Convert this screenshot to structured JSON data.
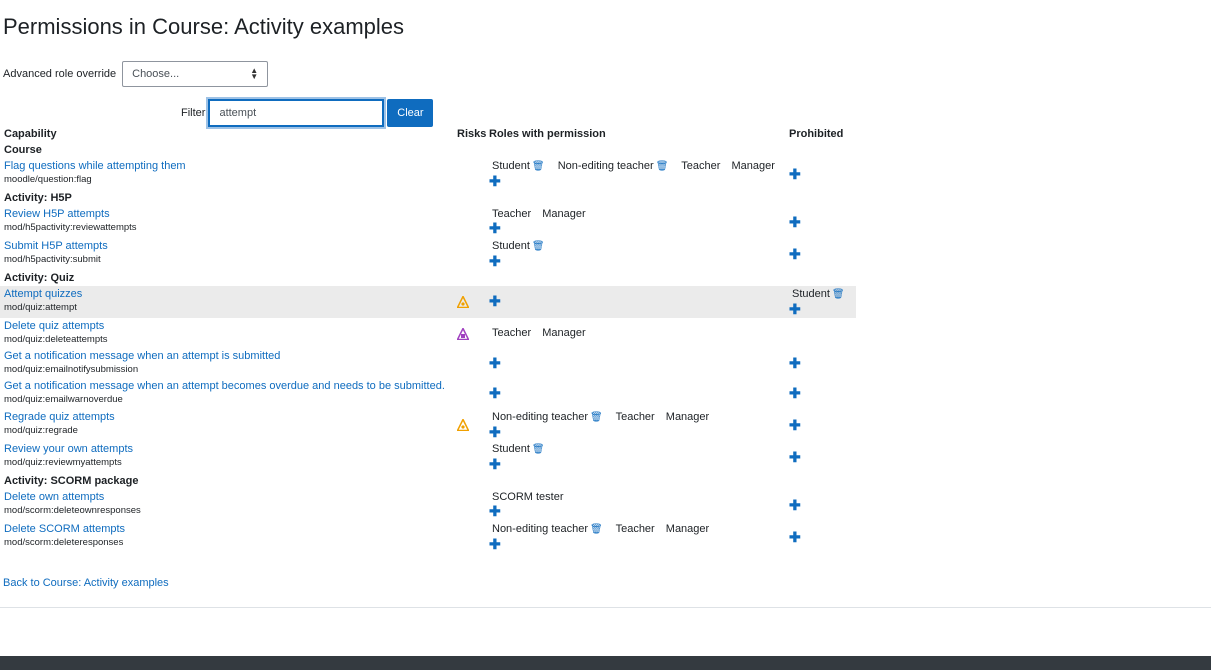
{
  "page_title": "Permissions in Course: Activity examples",
  "override": {
    "label": "Advanced role override",
    "select_value": "Choose..."
  },
  "filter": {
    "label": "Filter",
    "value": "attempt",
    "clear_label": "Clear"
  },
  "headers": {
    "capability": "Capability",
    "risks": "Risks",
    "roles": "Roles with permission",
    "prohibited": "Prohibited"
  },
  "sections": [
    {
      "title": "Course"
    },
    {
      "title": "Activity: H5P"
    },
    {
      "title": "Activity: Quiz"
    },
    {
      "title": "Activity: SCORM package"
    }
  ],
  "rows": [
    {
      "name": "Flag questions while attempting them",
      "code": "moodle/question:flag"
    },
    {
      "name": "Review H5P attempts",
      "code": "mod/h5pactivity:reviewattempts"
    },
    {
      "name": "Submit H5P attempts",
      "code": "mod/h5pactivity:submit"
    },
    {
      "name": "Attempt quizzes",
      "code": "mod/quiz:attempt"
    },
    {
      "name": "Delete quiz attempts",
      "code": "mod/quiz:deleteattempts"
    },
    {
      "name": "Get a notification message when an attempt is submitted",
      "code": "mod/quiz:emailnotifysubmission"
    },
    {
      "name": "Get a notification message when an attempt becomes overdue and needs to be submitted.",
      "code": "mod/quiz:emailwarnoverdue"
    },
    {
      "name": "Regrade quiz attempts",
      "code": "mod/quiz:regrade"
    },
    {
      "name": "Review your own attempts",
      "code": "mod/quiz:reviewmyattempts"
    },
    {
      "name": "Delete own attempts",
      "code": "mod/scorm:deleteownresponses"
    },
    {
      "name": "Delete SCORM attempts",
      "code": "mod/scorm:deleteresponses"
    }
  ],
  "roles": {
    "student": "Student",
    "non_editing_teacher": "Non-editing teacher",
    "teacher": "Teacher",
    "manager": "Manager",
    "scorm_tester": "SCORM tester"
  },
  "risk_colors": {
    "config": "#f0a000",
    "spam": "#a040c0"
  },
  "back_link": "Back to Course: Activity examples"
}
